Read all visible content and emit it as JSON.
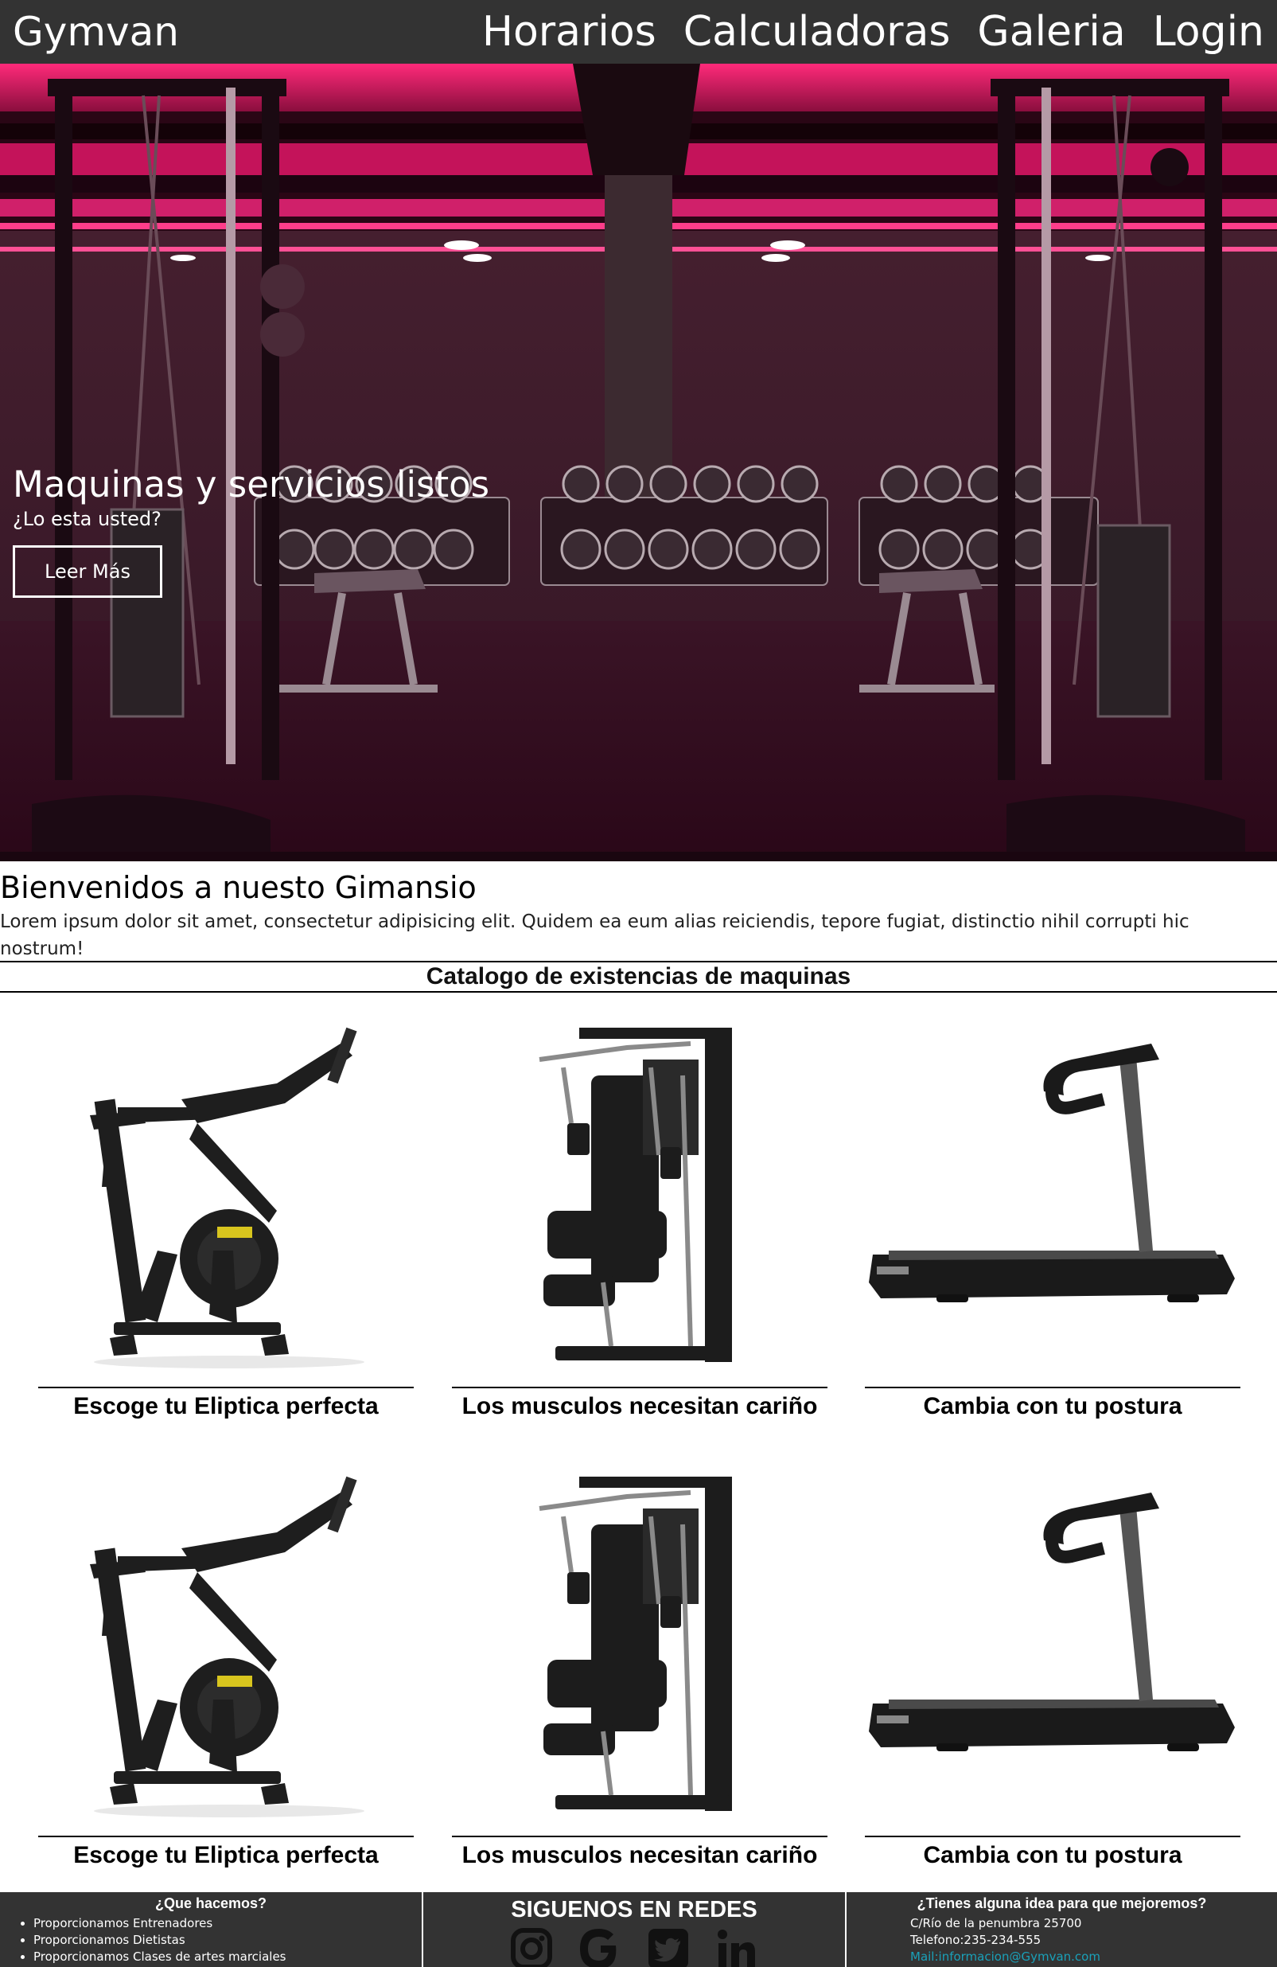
{
  "navbar": {
    "brand": "Gymvan",
    "links": [
      "Horarios",
      "Calculadoras",
      "Galeria",
      "Login"
    ]
  },
  "hero": {
    "title": "Maquinas y servicios listos",
    "subtitle": "¿Lo esta usted?",
    "button_label": "Leer Más"
  },
  "welcome": {
    "title": "Bienvenidos a nuesto Gimansio",
    "text": "Lorem ipsum dolor sit amet, consectetur adipisicing elit. Quidem ea eum alias reiciendis, tepore fugiat, distinctio nihil corrupti hic nostrum!"
  },
  "catalog": {
    "title": "Catalogo de existencias de maquinas",
    "products": [
      {
        "caption": "Escoge tu Eliptica perfecta",
        "image": "exercise-bike"
      },
      {
        "caption": "Los musculos necesitan cariño",
        "image": "multi-gym-machine"
      },
      {
        "caption": "Cambia con tu postura",
        "image": "treadmill"
      },
      {
        "caption": "Escoge tu Eliptica perfecta",
        "image": "exercise-bike"
      },
      {
        "caption": "Los musculos necesitan cariño",
        "image": "multi-gym-machine"
      },
      {
        "caption": "Cambia con tu postura",
        "image": "treadmill"
      }
    ]
  },
  "footer": {
    "about": {
      "heading": "¿Que hacemos?",
      "items": [
        "Proporcionamos Entrenadores",
        "Proporcionamos Dietistas",
        "Proporcionamos Clases de artes marciales"
      ]
    },
    "social": {
      "heading": "SIGUENOS EN REDES",
      "icons": [
        "instagram-icon",
        "google-icon",
        "twitter-icon",
        "linkedin-icon"
      ]
    },
    "contact": {
      "heading": "¿Tienes alguna idea para que mejoremos?",
      "address": "C/Río de la penumbra 25700",
      "phone": "Telefono:235-234-555",
      "mail": "Mail:informacion@Gymvan.com"
    }
  },
  "colors": {
    "navbar_bg": "#333333",
    "footer_bg": "#333333",
    "hero_accent": "#e0195f",
    "mail_link": "#1aa0b8"
  }
}
